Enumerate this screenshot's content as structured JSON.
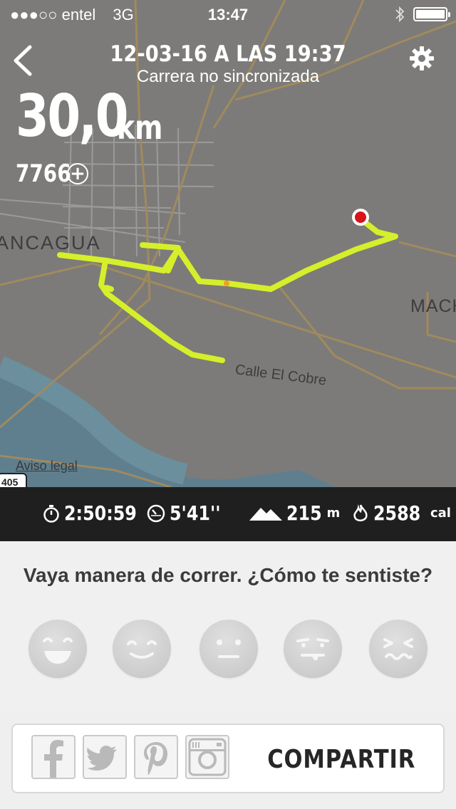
{
  "status_bar": {
    "signal": "●●●○○",
    "carrier": "entel",
    "network": "3G",
    "time": "13:47",
    "bluetooth_icon": "bluetooth-icon",
    "battery_icon": "battery-icon"
  },
  "header": {
    "title": "12-03-16 A LAS 19:37",
    "subtitle": "Carrera no sincronizada",
    "back_icon": "chevron-left-icon",
    "settings_icon": "gear-icon"
  },
  "run": {
    "distance": "30,0",
    "distance_unit": "km",
    "fuel": "7766",
    "fuel_icon": "plus-circle-icon"
  },
  "map": {
    "labels": {
      "city": "ANCAGUA",
      "town": "MACH",
      "street": "Calle El Cobre",
      "legal": "Aviso legal",
      "route": "405"
    },
    "colors": {
      "land": "#7c7b79",
      "water": "#5f7f8f",
      "road": "#a08a5e",
      "track": "#d6ef2a"
    }
  },
  "stats": {
    "duration": "2:50:59",
    "pace": "5'41''",
    "elevation": "215",
    "elevation_unit": "m",
    "calories": "2588",
    "calories_unit": "cal"
  },
  "feedback": {
    "question": "Vaya manera de correr. ¿Cómo te sentiste?",
    "faces": [
      "great-face-icon",
      "happy-face-icon",
      "neutral-face-icon",
      "meh-face-icon",
      "bad-face-icon"
    ]
  },
  "share": {
    "label": "COMPARTIR",
    "icons": [
      "facebook-icon",
      "twitter-icon",
      "pinterest-icon",
      "instagram-icon"
    ]
  }
}
